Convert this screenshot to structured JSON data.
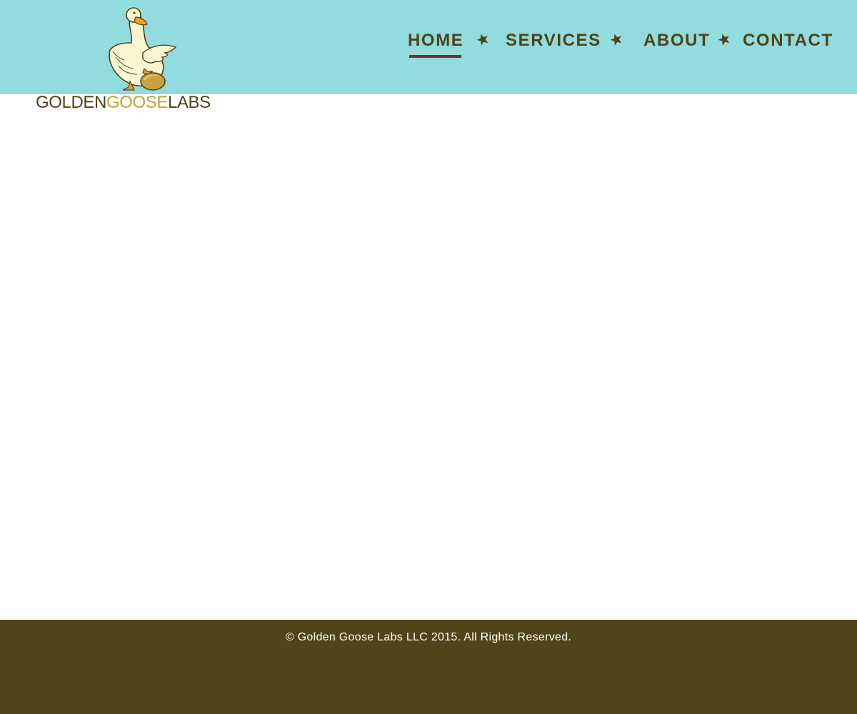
{
  "brand": {
    "logo_parts": [
      "GOLDEN",
      "GOOSE",
      "LABS"
    ],
    "colors": {
      "dark": "#4f4316",
      "gold": "#c3a23c"
    }
  },
  "nav": {
    "items": [
      {
        "label": "HOME",
        "active": true
      },
      {
        "label": "SERVICES",
        "active": false
      },
      {
        "label": "ABOUT",
        "active": false
      },
      {
        "label": "CONTACT",
        "active": false
      }
    ],
    "separator_icon": "star-icon"
  },
  "footer": {
    "copyright": "© Golden Goose Labs LLC 2015. All Rights Reserved."
  },
  "colors": {
    "header_bg": "#92dcdf",
    "footer_bg": "#514418",
    "nav_text": "#4f4316",
    "active_underline": "#8c2526"
  }
}
